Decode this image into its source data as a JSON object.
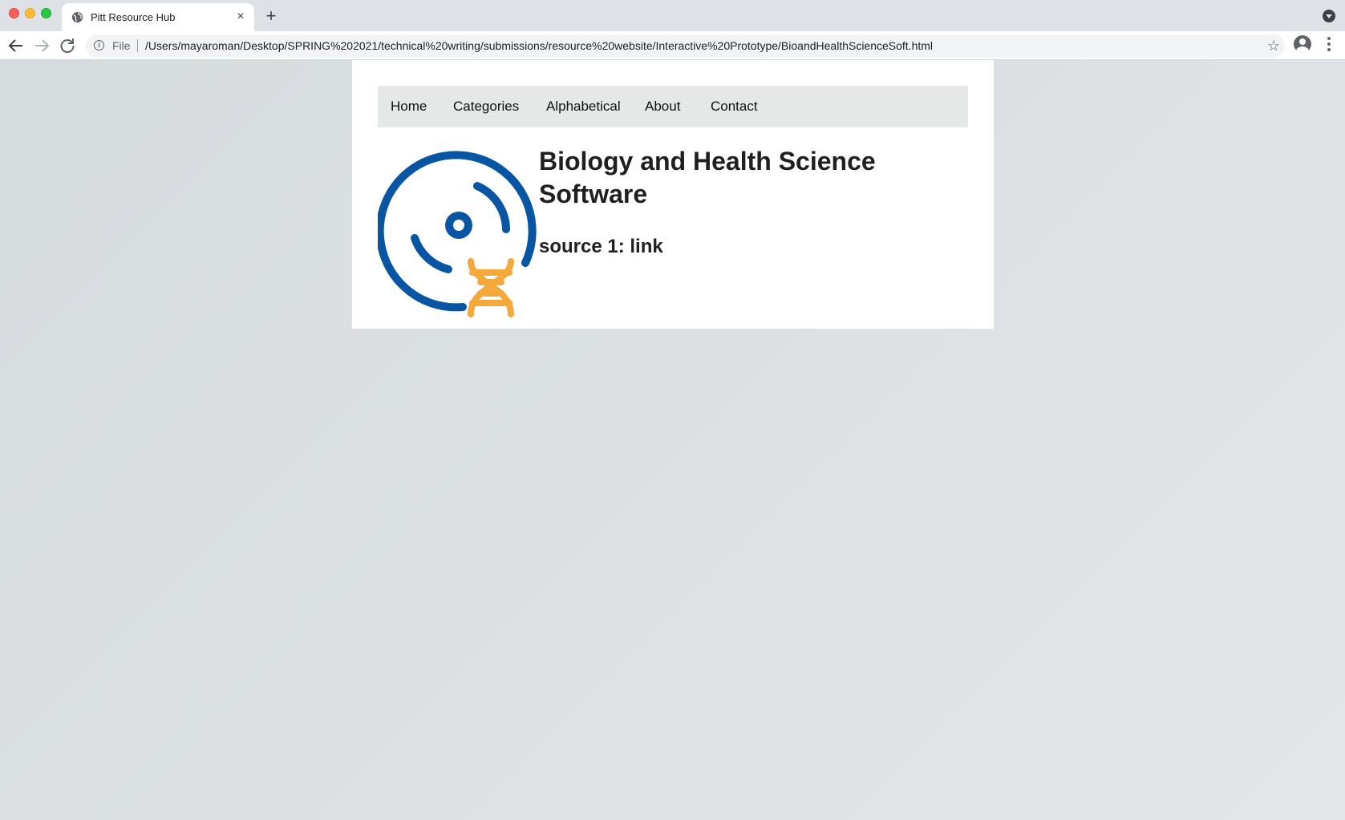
{
  "browser": {
    "tab_title": "Pitt Resource Hub",
    "tab_close": "×",
    "new_tab": "+",
    "url_scheme": "File",
    "url": "/Users/mayaroman/Desktop/SPRING%202021/technical%20writing/submissions/resource%20website/Interactive%20Prototype/BioandHealthScienceSoft.html",
    "icons": {
      "back": "arrow-left-icon",
      "forward": "arrow-right-icon",
      "reload": "reload-icon",
      "info": "info-icon",
      "bookmark": "star-icon",
      "profile": "profile-icon",
      "menu": "kebab-menu-icon"
    }
  },
  "nav": {
    "items": [
      {
        "label": "Home"
      },
      {
        "label": "Categories"
      },
      {
        "label": "Alphabetical"
      },
      {
        "label": "About"
      },
      {
        "label": "Contact"
      }
    ]
  },
  "main": {
    "title": "Biology and Health Science Software",
    "source_text": "source 1: link",
    "logo_icon": "disc-dna-icon"
  },
  "colors": {
    "logo_blue": "#0755a3",
    "logo_orange": "#f6a93b",
    "nav_bg": "#e6e7e7",
    "page_bg": "#dde1e3"
  }
}
